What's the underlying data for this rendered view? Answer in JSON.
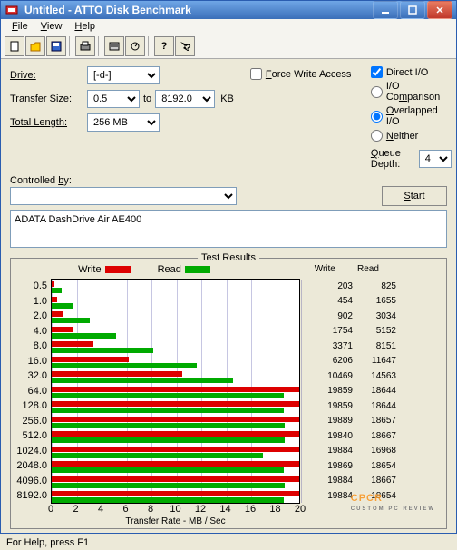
{
  "window": {
    "title": "Untitled - ATTO Disk Benchmark"
  },
  "menu": {
    "file": "File",
    "view": "View",
    "help": "Help"
  },
  "form": {
    "drive_label": "Drive:",
    "drive_value": "[-d-]",
    "transfer_label": "Transfer Size:",
    "transfer_from": "0.5",
    "transfer_to_label": "to",
    "transfer_to": "8192.0",
    "transfer_unit": "KB",
    "length_label": "Total Length:",
    "length_value": "256 MB",
    "force_write": "Force Write Access",
    "direct_io": "Direct I/O",
    "io_comparison": "I/O Comparison",
    "overlapped_io": "Overlapped I/O",
    "neither": "Neither",
    "queue_depth_label": "Queue Depth:",
    "queue_depth_value": "4",
    "controlled_by_label": "Controlled by:",
    "start": "Start",
    "description": "ADATA DashDrive Air AE400"
  },
  "results": {
    "title": "Test Results",
    "write_label": "Write",
    "read_label": "Read",
    "xlabel": "Transfer Rate - MB / Sec"
  },
  "chart_data": {
    "type": "bar",
    "orientation": "horizontal",
    "categories": [
      "0.5",
      "1.0",
      "2.0",
      "4.0",
      "8.0",
      "16.0",
      "32.0",
      "64.0",
      "128.0",
      "256.0",
      "512.0",
      "1024.0",
      "2048.0",
      "4096.0",
      "8192.0"
    ],
    "series": [
      {
        "name": "Write",
        "color": "#d00",
        "values": [
          203,
          454,
          902,
          1754,
          3371,
          6206,
          10469,
          19859,
          19859,
          19889,
          19840,
          19884,
          19869,
          19884,
          19884
        ]
      },
      {
        "name": "Read",
        "color": "#0a0",
        "values": [
          825,
          1655,
          3034,
          5152,
          8151,
          11647,
          14563,
          18644,
          18644,
          18657,
          18667,
          16968,
          18654,
          18667,
          18654
        ]
      }
    ],
    "xlabel": "Transfer Rate - MB / Sec",
    "xlim": [
      0,
      20
    ],
    "xticks": [
      0,
      2,
      4,
      6,
      8,
      10,
      12,
      14,
      16,
      18,
      20
    ],
    "unit": "KB (write/read values shown in KB/s in table; bars plotted in MB/s)"
  },
  "status": {
    "text": "For Help, press F1"
  },
  "watermark": {
    "text": "CPCR",
    "sub": "CUSTOM PC REVIEW"
  },
  "colors": {
    "write": "#d00",
    "read": "#0a0"
  }
}
